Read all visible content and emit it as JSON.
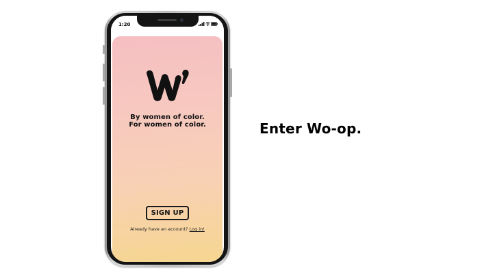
{
  "status_bar": {
    "time": "1:20"
  },
  "app": {
    "logo_text": "W'",
    "tagline_line1": "By women of color.",
    "tagline_line2": "For women of color.",
    "signup_label": "SIGN UP",
    "login_prompt": "Already have an account?",
    "login_link": "Log in!"
  },
  "slide": {
    "headline": "Enter Wo-op."
  },
  "colors": {
    "gradient_top": "#f6bfc2",
    "gradient_bottom": "#f6d690",
    "text": "#111111"
  }
}
